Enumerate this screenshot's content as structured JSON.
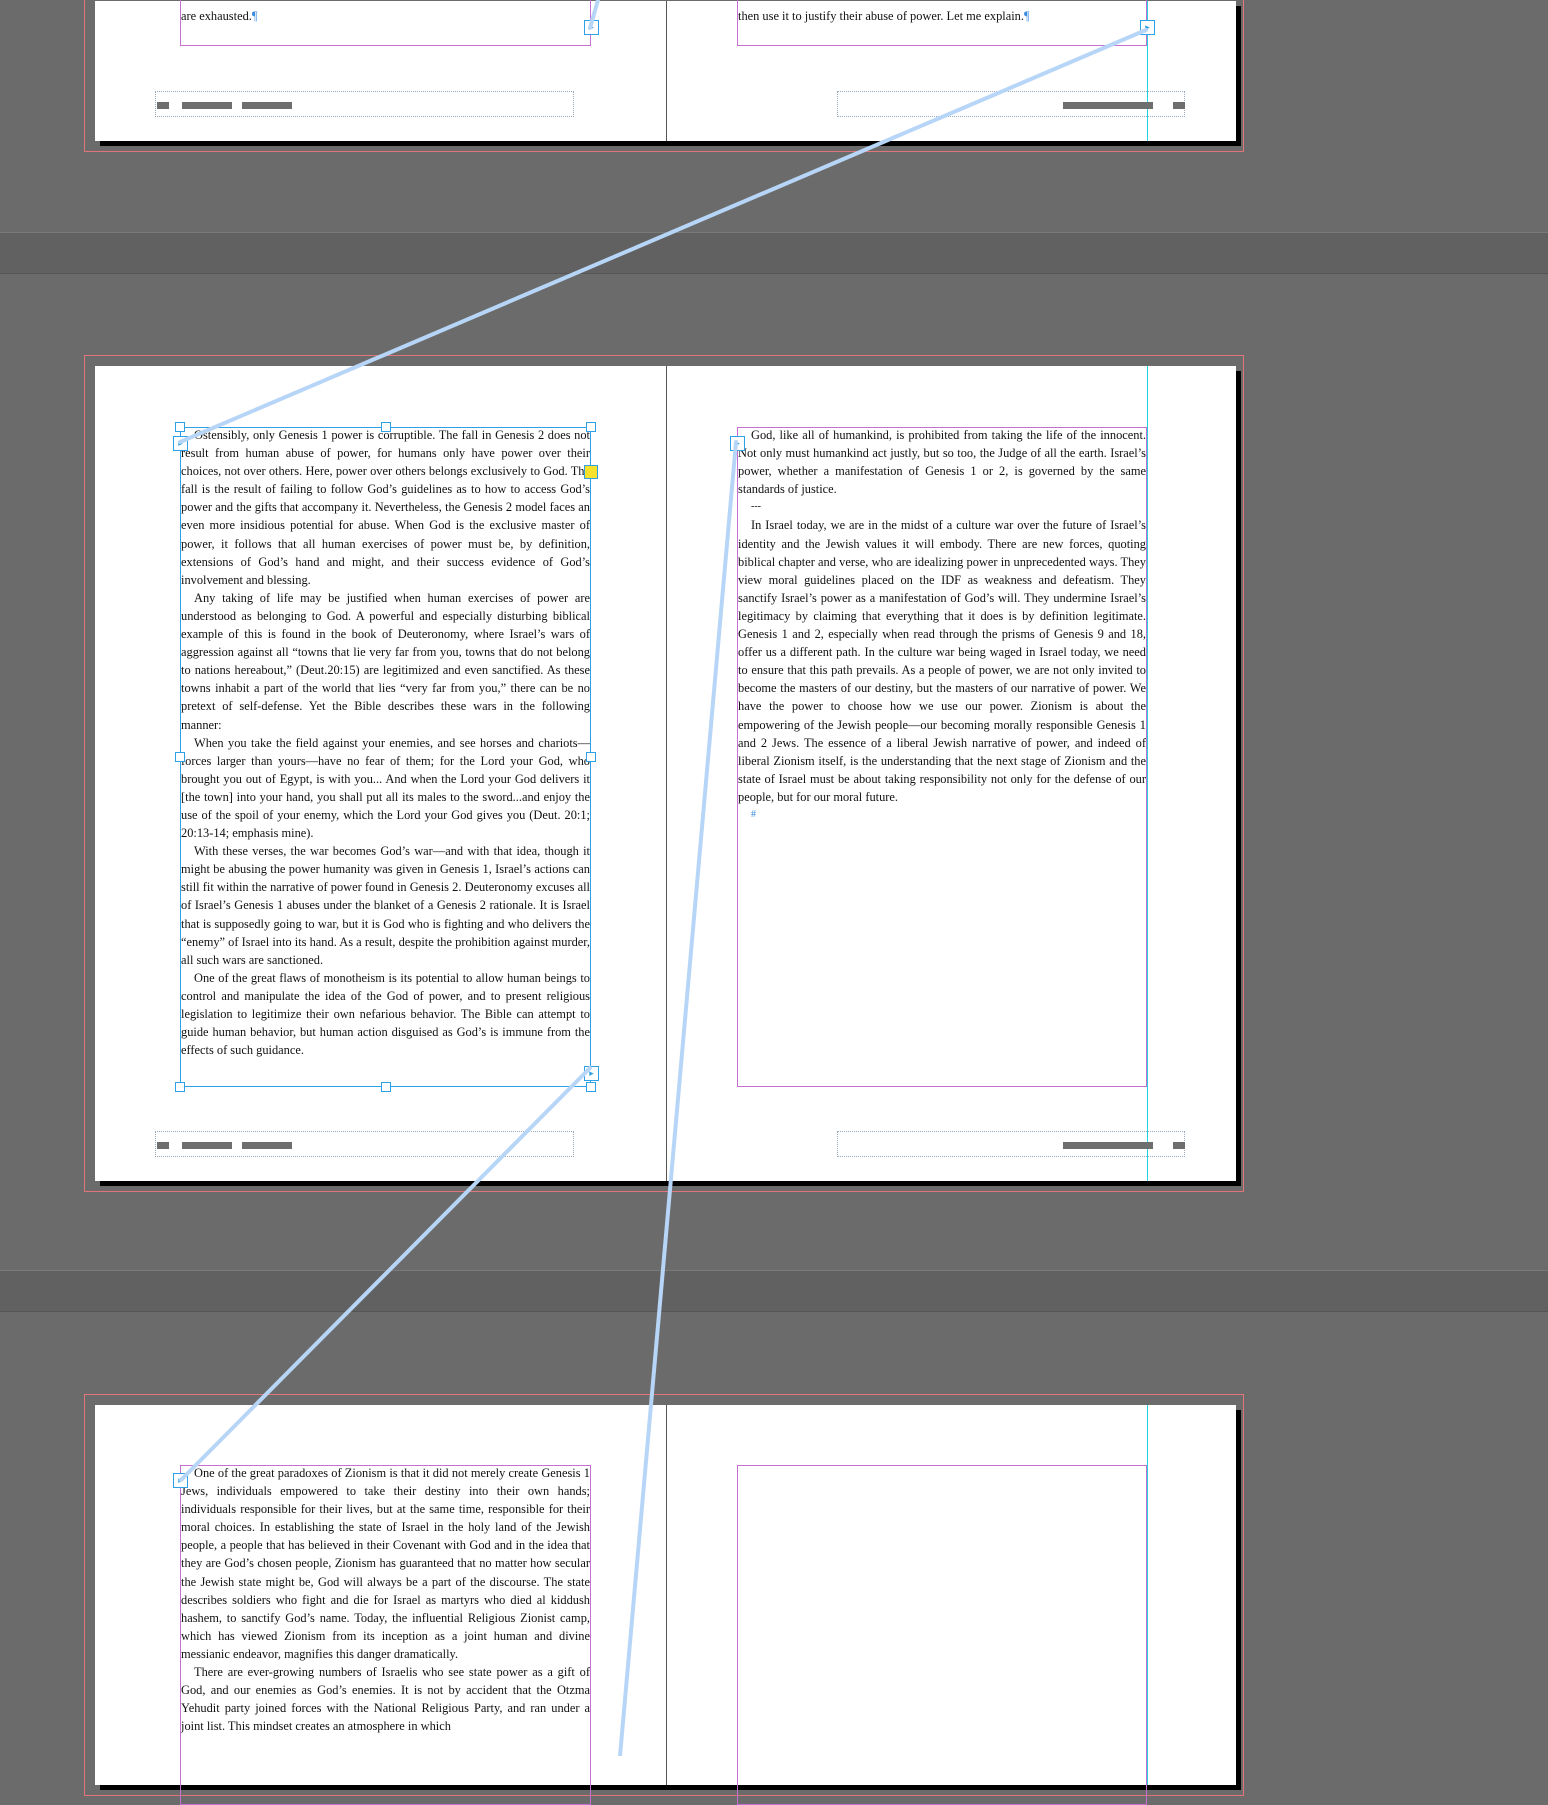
{
  "spread1": {
    "left_tail": "are exhausted.",
    "right_tail": "then use it to justify their abuse of power. Let me explain."
  },
  "spread2": {
    "left_paragraphs": [
      "Ostensibly, only Genesis 1 power is corruptible. The fall in Genesis 2 does not result from human abuse of power, for humans only have power over their choices, not over others. Here, power over others belongs exclusively to God. The fall is the result of failing to follow God’s guidelines as to how to access God’s power and the gifts that accompany it. Nevertheless, the Genesis 2 model faces an even more insidious potential for abuse. When God is the exclusive master of power, it follows that all human exercises of power must be, by definition, extensions of God’s hand and might, and their success evidence of God’s involvement and blessing.",
      "Any taking of life may be justified when human exercises of power are understood as belonging to God. A powerful and especially disturbing biblical example of this is found in the book of Deuteronomy, where Israel’s wars of aggression against all “towns that lie very far from you, towns that do not belong to nations hereabout,” (Deut.20:15) are legitimized and even sanctified. As these towns inhabit a part of the world that lies “very far from you,” there can be no pretext of self-defense. Yet the Bible describes these wars in the following manner:",
      "When you take the field against your enemies, and see horses and chariots—forces larger than yours—have no fear of them; for the Lord your God, who brought you out of Egypt, is with you... And when the Lord your God delivers it [the town] into your hand, you shall put all its males to the sword...and enjoy the use of the spoil of your enemy, which the Lord your God gives you (Deut. 20:1; 20:13-14; emphasis mine).",
      "With these verses, the war becomes God’s war—and with that idea, though it might be abusing the power humanity was given in Genesis 1, Israel’s actions can still fit within the narrative of power found in Genesis 2. Deuteronomy excuses all of Israel’s Genesis 1 abuses under the blanket of a Genesis 2 rationale. It is Israel that is supposedly going to war, but it is God who is fighting and who delivers the “enemy” of Israel into its hand. As a result, despite the prohibition against murder, all such wars are sanctioned.",
      "One of the great flaws of monotheism is its potential to allow human beings to control and manipulate the idea of the God of power, and to present religious legislation to legitimize their own nefarious behavior. The Bible can attempt to guide human behavior, but human action disguised as God’s is immune from the effects of such guidance."
    ],
    "right_paragraphs": [
      "God, like all of humankind, is prohibited from taking the life of the innocent. Not only must humankind act justly, but so too, the Judge of all the earth. Israel’s power, whether a manifestation of Genesis 1 or 2, is governed by the same standards of justice.",
      "---",
      "In Israel today, we are in the midst of a culture war over the future of Israel’s identity and the Jewish values it will embody. There are new forces, quoting biblical chapter and verse, who are idealizing power in unprecedented ways. They view moral guidelines placed on the IDF as weakness and defeatism. They sanctify Israel’s power as a manifestation of God’s will. They undermine Israel’s legitimacy by claiming that everything that it does is by definition legitimate. Genesis 1 and 2, especially when read through the prisms of Genesis 9 and 18, offer us a different path. In the culture war being waged in Israel today, we need to ensure that this path prevails. As a people of power, we are not only invited to become the masters of our destiny, but the masters of our narrative of power. We have the power to choose how we use our power. Zionism is about the empowering of the Jewish people—our becoming morally responsible Genesis 1 and 2 Jews. The essence of a liberal Jewish narrative of power, and indeed of liberal Zionism itself, is the understanding that the next stage of Zionism and the state of Israel must be about taking responsibility not only for the defense of our people, but for our moral future.",
      "#"
    ]
  },
  "spread3": {
    "left_paragraphs": [
      "One of the great paradoxes of Zionism is that it did not merely create Genesis 1 Jews, individuals empowered to take their destiny into their own hands; individuals responsible for their lives, but at the same time, responsible for their moral choices. In establishing the state of Israel in the holy land of the Jewish people, a people that has believed in their Covenant with God and in the idea that they are God’s chosen people, Zionism has guaranteed that no matter how secular the Jewish state might be, God will always be a part of the discourse. The state describes soldiers who fight and die for Israel as martyrs who died al kiddush hashem, to sanctify God’s name. Today, the influential Religious Zionist camp, which has viewed Zionism from its inception as a joint human and divine messianic endeavor, magnifies this danger dramatically.",
      "There are ever-growing numbers of Israelis who see state power as a gift of God, and our enemies as God’s enemies. It is not by accident that the Otzma Yehudit party joined forces with the National Religious Party, and ran under a joint list. This mindset creates an atmosphere in which"
    ]
  },
  "colors": {
    "frame": "#c66fd0",
    "selection": "#2ea0e6",
    "thread": "#b7d6f7",
    "bleed": "#e0757a",
    "margin_guide": "#22d3e6",
    "overset": "#f7e12a"
  }
}
